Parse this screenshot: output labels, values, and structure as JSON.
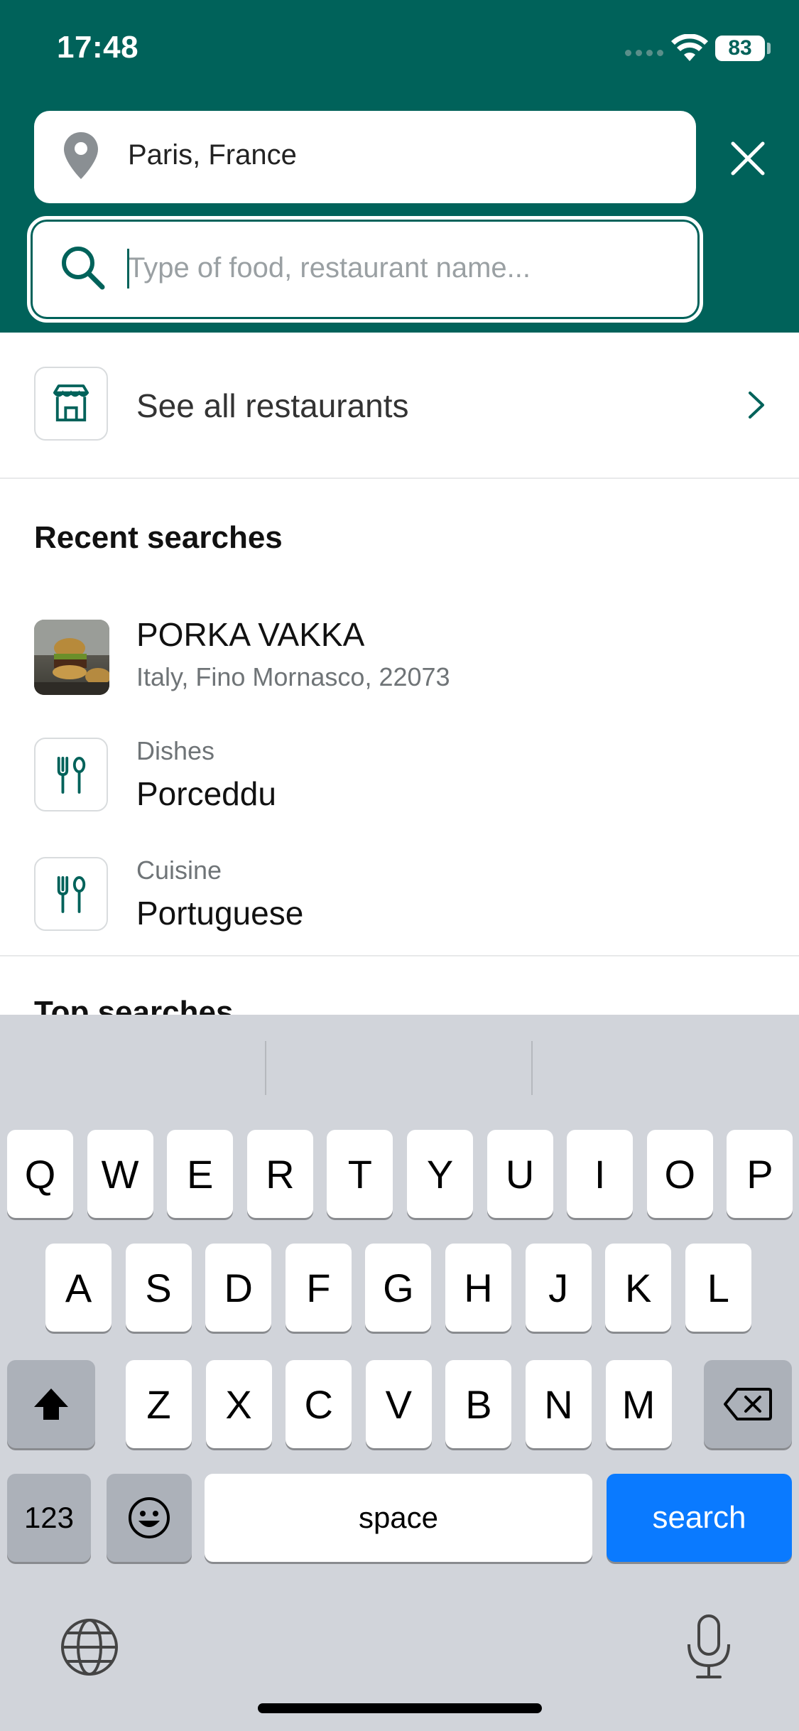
{
  "status_bar": {
    "time": "17:48",
    "battery": "83"
  },
  "header": {
    "location": "Paris, France",
    "search_placeholder": "Type of food, restaurant name...",
    "search_value": ""
  },
  "see_all": {
    "label": "See all restaurants"
  },
  "recent": {
    "title": "Recent searches",
    "items": [
      {
        "title": "PORKA VAKKA",
        "subtitle": "Italy, Fino Mornasco, 22073"
      },
      {
        "category": "Dishes",
        "title": "Porceddu"
      },
      {
        "category": "Cuisine",
        "title": "Portuguese"
      }
    ]
  },
  "top_searches": {
    "title": "Top searches"
  },
  "keyboard": {
    "row1": [
      "Q",
      "W",
      "E",
      "R",
      "T",
      "Y",
      "U",
      "I",
      "O",
      "P"
    ],
    "row2": [
      "A",
      "S",
      "D",
      "F",
      "G",
      "H",
      "J",
      "K",
      "L"
    ],
    "row3": [
      "Z",
      "X",
      "C",
      "V",
      "B",
      "N",
      "M"
    ],
    "numbers_key": "123",
    "space_key": "space",
    "action_key": "search"
  },
  "colors": {
    "brand": "#00625A",
    "keyboard_bg": "#D1D4DA",
    "action_blue": "#0A7AFF"
  },
  "icons": [
    "location-pin-icon",
    "close-icon",
    "search-icon",
    "store-icon",
    "chevron-right-icon",
    "cutlery-icon",
    "shift-icon",
    "backspace-icon",
    "emoji-icon",
    "globe-icon",
    "microphone-icon"
  ]
}
